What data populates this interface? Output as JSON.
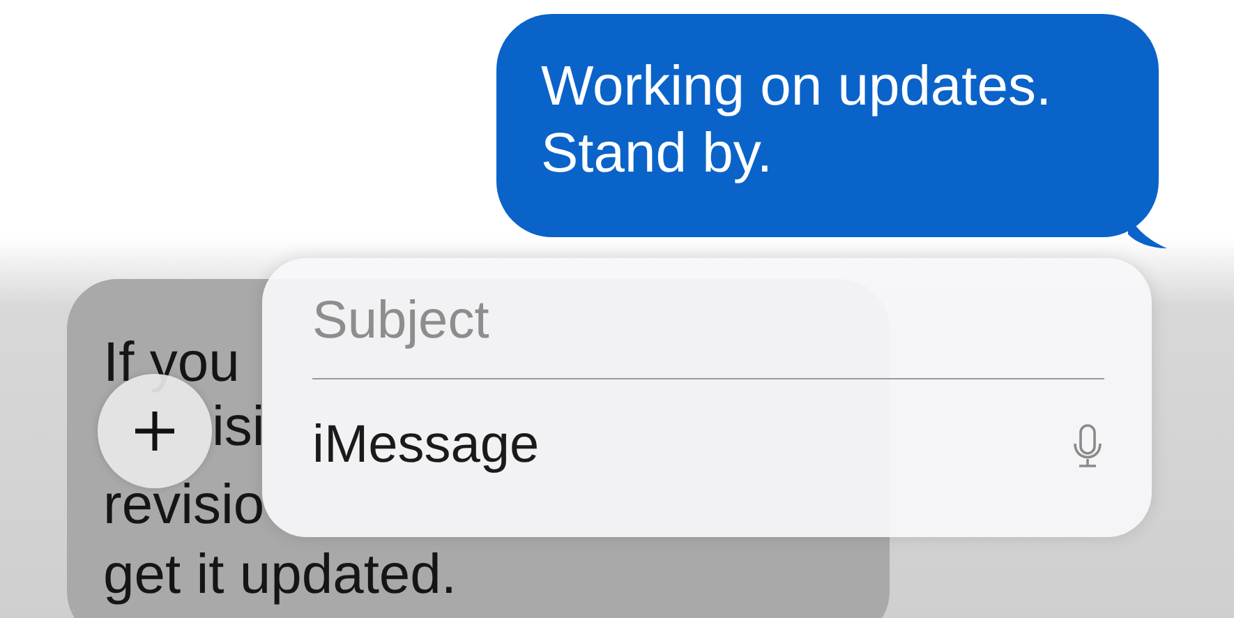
{
  "outgoing_message": {
    "lines": [
      "Working on updates.",
      "Stand by."
    ]
  },
  "incoming_message": {
    "lines": [
      "If you",
      "isi",
      "revisio",
      "get it updated."
    ]
  },
  "compose": {
    "subject_placeholder": "Subject",
    "message_placeholder": "iMessage"
  }
}
